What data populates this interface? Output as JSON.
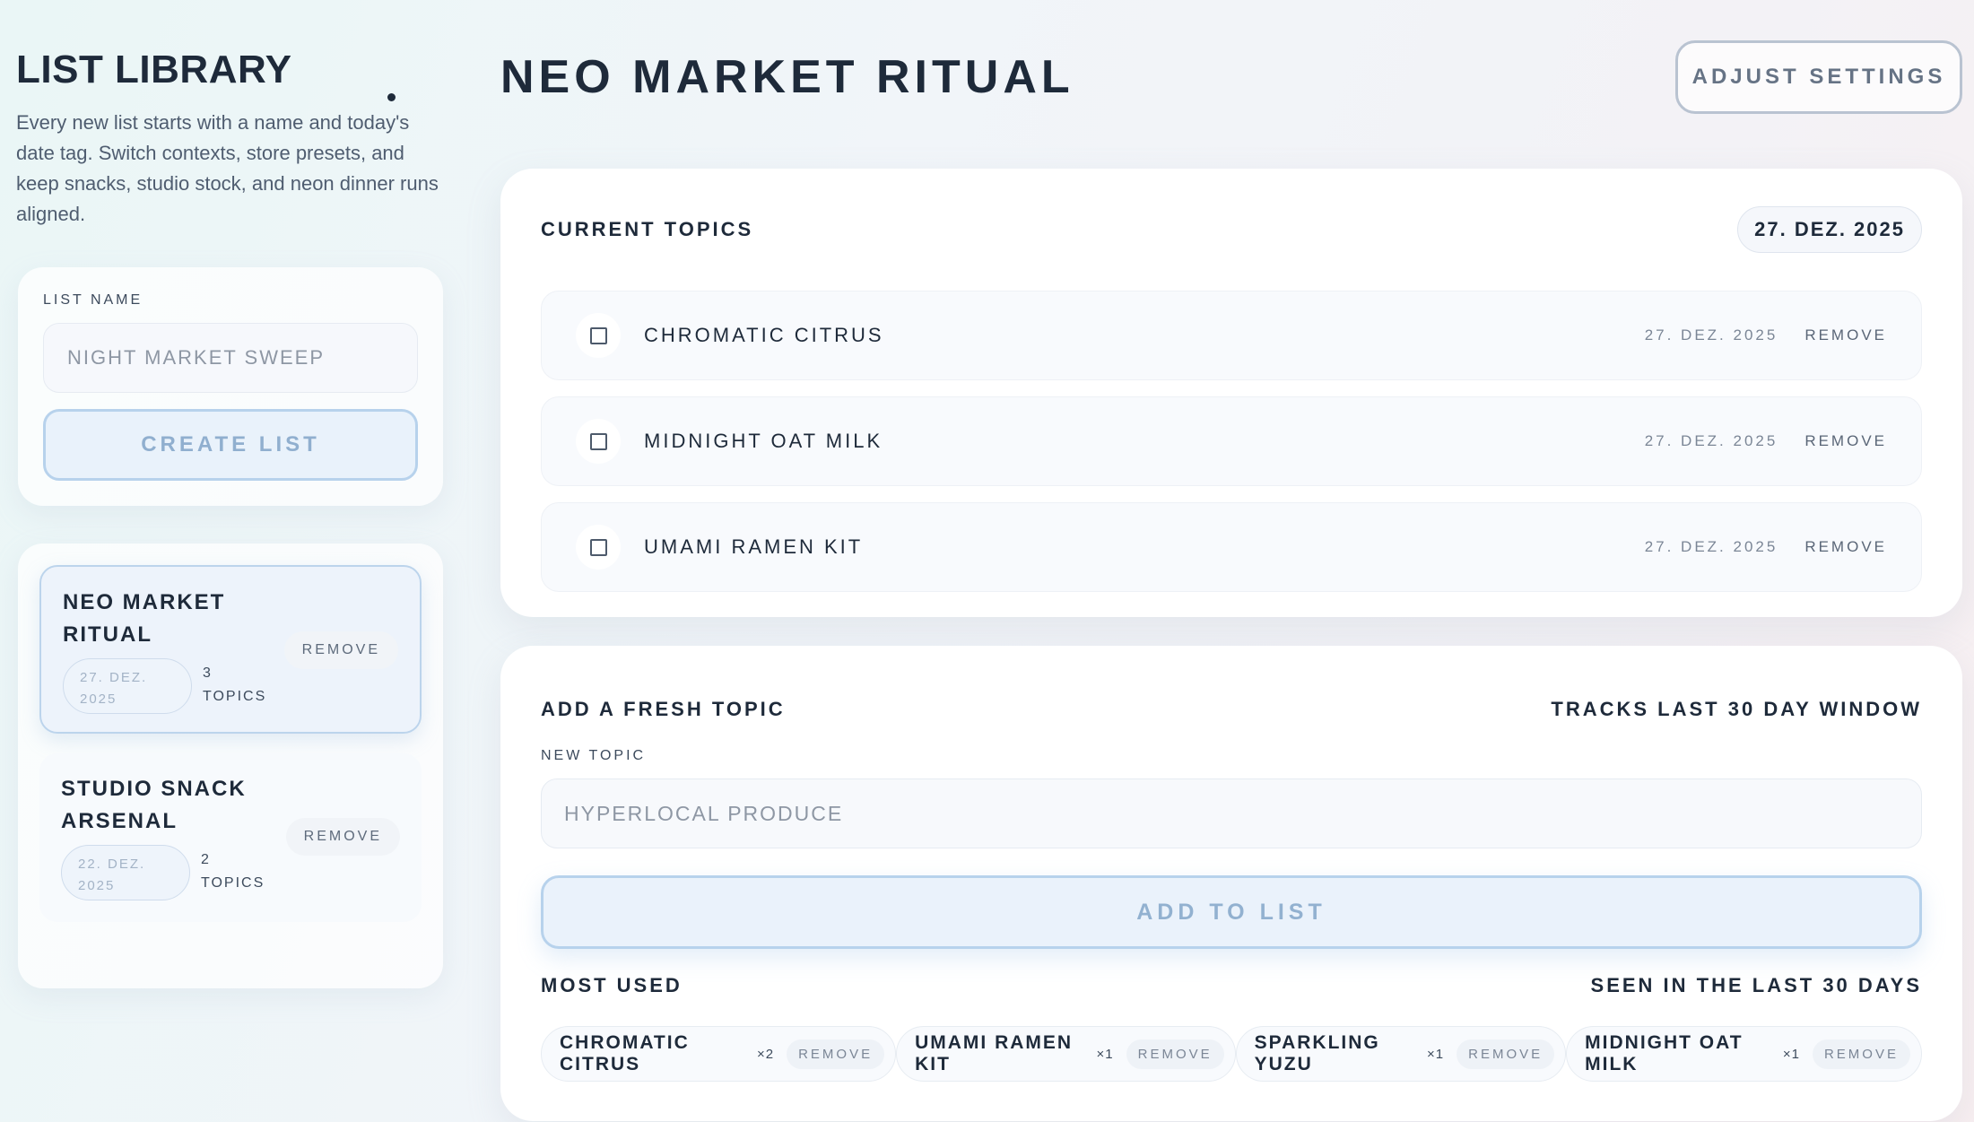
{
  "sidebar": {
    "title": "LIST LIBRARY",
    "description": "Every new list starts with a name and today's date tag. Switch contexts, store presets, and keep snacks, studio stock, and neon dinner runs aligned.",
    "create": {
      "label": "LIST NAME",
      "placeholder": "NIGHT MARKET SWEEP",
      "button": "CREATE LIST"
    },
    "lists": [
      {
        "name": "NEO MARKET RITUAL",
        "date": "27. DEZ. 2025",
        "count": "3",
        "count_label": "TOPICS",
        "remove": "REMOVE",
        "active": true
      },
      {
        "name": "STUDIO SNACK ARSENAL",
        "date": "22. DEZ. 2025",
        "count": "2",
        "count_label": "TOPICS",
        "remove": "REMOVE",
        "active": false
      }
    ]
  },
  "header": {
    "title": "NEO MARKET RITUAL",
    "settings_button": "ADJUST SETTINGS"
  },
  "topics": {
    "title": "CURRENT TOPICS",
    "date": "27. DEZ. 2025",
    "items": [
      {
        "name": "CHROMATIC CITRUS",
        "date": "27. DEZ. 2025",
        "remove": "REMOVE",
        "checked": false
      },
      {
        "name": "MIDNIGHT OAT MILK",
        "date": "27. DEZ. 2025",
        "remove": "REMOVE",
        "checked": false
      },
      {
        "name": "UMAMI RAMEN KIT",
        "date": "27. DEZ. 2025",
        "remove": "REMOVE",
        "checked": false
      }
    ]
  },
  "add": {
    "title": "ADD A FRESH TOPIC",
    "window_note": "TRACKS LAST 30 DAY WINDOW",
    "field_label": "NEW TOPIC",
    "placeholder": "HYPERLOCAL PRODUCE",
    "button": "ADD TO LIST"
  },
  "most_used": {
    "title": "MOST USED",
    "note": "SEEN IN THE LAST 30 DAYS",
    "chips": [
      {
        "name": "CHROMATIC CITRUS",
        "count": "×2",
        "remove": "REMOVE"
      },
      {
        "name": "UMAMI RAMEN KIT",
        "count": "×1",
        "remove": "REMOVE"
      },
      {
        "name": "SPARKLING YUZU",
        "count": "×1",
        "remove": "REMOVE"
      },
      {
        "name": "MIDNIGHT OAT MILK",
        "count": "×1",
        "remove": "REMOVE"
      }
    ]
  },
  "colors": {
    "text": "#1e2a3a",
    "accent_border": "#b7d2ec",
    "accent_fill": "#e9f2fb",
    "accent_text": "#90afcf"
  }
}
